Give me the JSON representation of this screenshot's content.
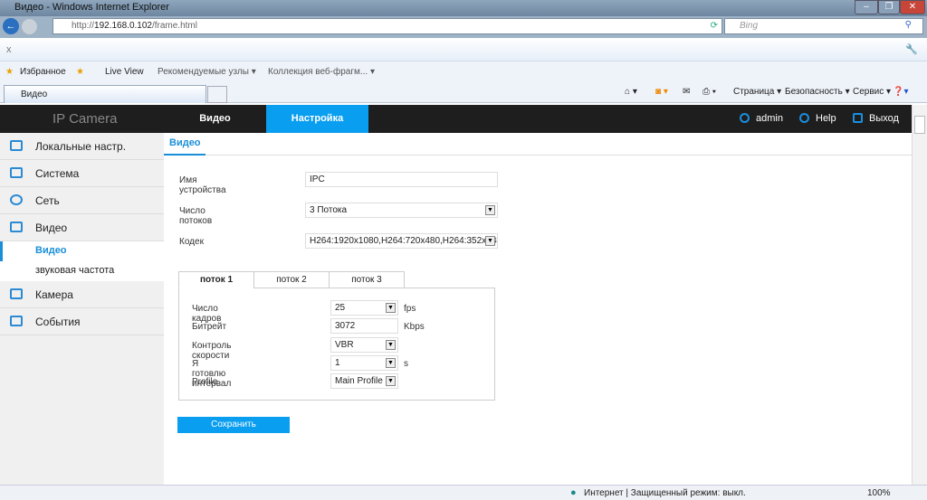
{
  "browser": {
    "title": "Видео - Windows Internet Explorer",
    "url_prefix": "http://",
    "url_host": "192.168.0.102",
    "url_path": "/frame.html",
    "search_placeholder": "Bing",
    "close_x": "x",
    "favorites": [
      "Избранное",
      "Live View",
      "Рекомендуемые узлы ▾",
      "Коллекция веб-фрагм... ▾"
    ],
    "tab": "Видео",
    "commands": [
      "Страница ▾",
      "Безопасность ▾",
      "Сервис ▾"
    ],
    "status": "Интернет | Защищенный режим: выкл.",
    "zoom": "100%"
  },
  "nav": {
    "logo": "IP Camera",
    "tabs": [
      "Видео",
      "Настройка"
    ],
    "active_tab": 1,
    "user": "admin",
    "help": "Help",
    "logout": "Выход",
    "accent": "#0a9ef0"
  },
  "sidebar": {
    "items": [
      "Локальные настр.",
      "Система",
      "Сеть",
      "Видео"
    ],
    "sub": [
      "Видео",
      "звуковая частота"
    ],
    "items2": [
      "Камера",
      "События"
    ]
  },
  "content": {
    "heading": "Видео",
    "device_name_label": "Имя устройства",
    "device_name": "IPC",
    "streams_label": "Число потоков",
    "streams": "3 Потока",
    "codec_label": "Кодек",
    "codec": "H264:1920x1080,H264:720x480,H264:352x288",
    "tabs": [
      "поток 1",
      "поток 2",
      "поток 3"
    ],
    "rows": [
      {
        "label": "Число кадров",
        "value": "25",
        "unit": "fps"
      },
      {
        "label": "Битрейт",
        "value": "3072",
        "unit": "Kbps"
      },
      {
        "label": "Контроль скорости",
        "value": "VBR",
        "unit": ""
      },
      {
        "label": "Я готовлю интервал",
        "value": "1",
        "unit": "s"
      },
      {
        "label": "Profile",
        "value": "Main Profile",
        "unit": ""
      }
    ],
    "save": "Сохранить"
  }
}
